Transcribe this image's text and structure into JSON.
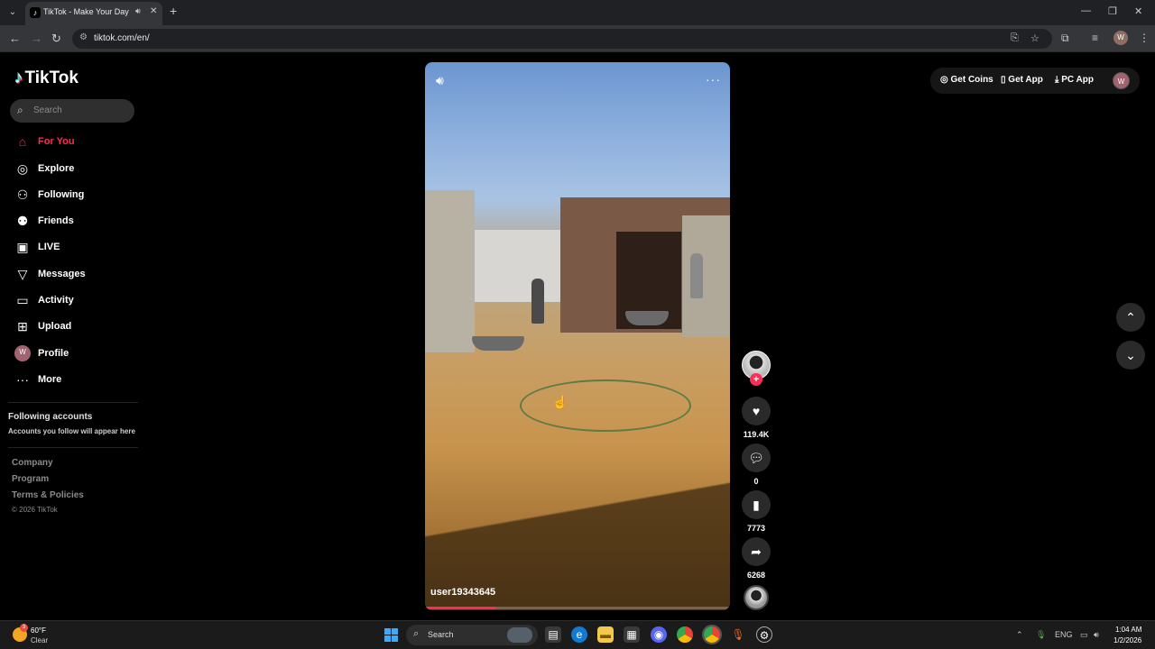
{
  "browser": {
    "tab_title": "TikTok - Make Your Day",
    "url": "tiktok.com/en/",
    "profile_initial": "W"
  },
  "sidebar": {
    "logo": "TikTok",
    "search_placeholder": "Search",
    "nav": [
      {
        "label": "For You",
        "icon": "home-icon",
        "active": true
      },
      {
        "label": "Explore",
        "icon": "compass-icon"
      },
      {
        "label": "Following",
        "icon": "person-plus-icon"
      },
      {
        "label": "Friends",
        "icon": "friends-icon"
      },
      {
        "label": "LIVE",
        "icon": "live-icon"
      },
      {
        "label": "Messages",
        "icon": "send-icon"
      },
      {
        "label": "Activity",
        "icon": "message-box-icon"
      },
      {
        "label": "Upload",
        "icon": "plus-box-icon"
      },
      {
        "label": "Profile",
        "icon": "avatar",
        "initial": "W"
      },
      {
        "label": "More",
        "icon": "ellipsis-icon"
      }
    ],
    "following_title": "Following accounts",
    "following_sub": "Accounts you follow will appear here",
    "footer_links": [
      "Company",
      "Program",
      "Terms & Policies"
    ],
    "copyright": "© 2026 TikTok"
  },
  "video": {
    "username": "user19343645",
    "progress": 0.23
  },
  "actions": {
    "likes": "119.4K",
    "comments": "0",
    "saves": "7773",
    "shares": "6268"
  },
  "top_actions": {
    "get_coins": "Get Coins",
    "get_app": "Get App",
    "pc_app": "PC App",
    "avatar_initial": "W"
  },
  "taskbar": {
    "temp": "60°F",
    "condition": "Clear",
    "weather_badge": "3",
    "search_placeholder": "Search",
    "language": "ENG",
    "time": "1:04 AM",
    "date": "1/2/2026"
  },
  "colors": {
    "accent": "#fe2c55",
    "cyan": "#25f4ee",
    "background": "#000000"
  }
}
